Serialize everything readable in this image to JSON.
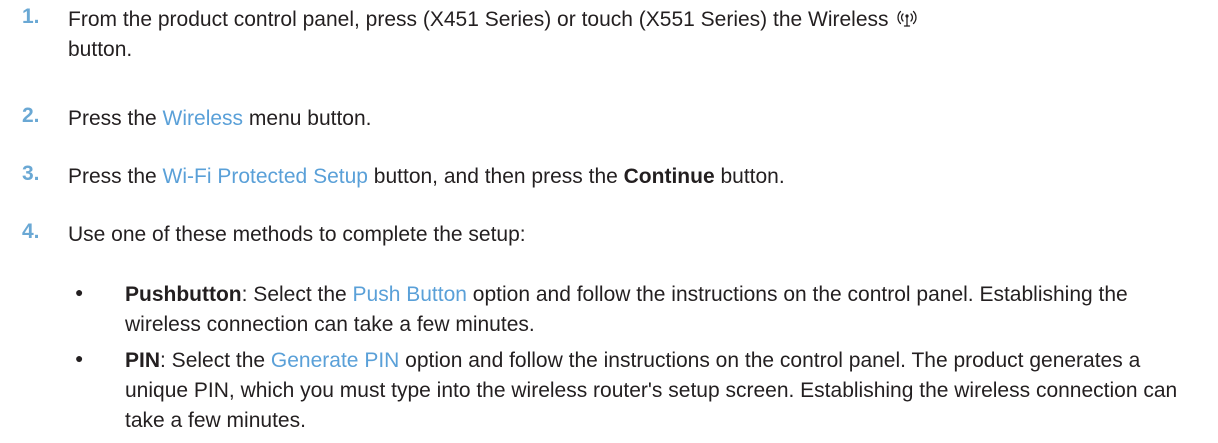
{
  "steps": [
    {
      "number": "1.",
      "pre": "From the product control panel, press (X451 Series) or touch (X551 Series) the Wireless",
      "icon": "wireless-icon",
      "line2": "button."
    },
    {
      "number": "2.",
      "pre": "Press the ",
      "ui": "Wireless",
      "post": " menu button."
    },
    {
      "number": "3.",
      "pre": "Press the ",
      "ui": "Wi-Fi Protected Setup",
      "mid": " button, and then press the ",
      "bold": "Continue",
      "post": " button."
    },
    {
      "number": "4.",
      "text": "Use one of these methods to complete the setup:"
    }
  ],
  "bullets": [
    {
      "symbol": "●",
      "term": "Pushbutton",
      "pre": ": Select the ",
      "ui": "Push Button",
      "post": " option and follow the instructions on the control panel. Establishing the wireless connection can take a few minutes."
    },
    {
      "symbol": "●",
      "term": "PIN",
      "pre": ": Select the ",
      "ui": "Generate PIN",
      "post": " option and follow the instructions on the control panel. The product generates a unique PIN, which you must type into the wireless router's setup screen. Establishing the wireless connection can take a few minutes."
    }
  ],
  "colors": {
    "number": "#6aa8d4",
    "ui_link": "#5aa0d8",
    "text": "#231f20"
  }
}
